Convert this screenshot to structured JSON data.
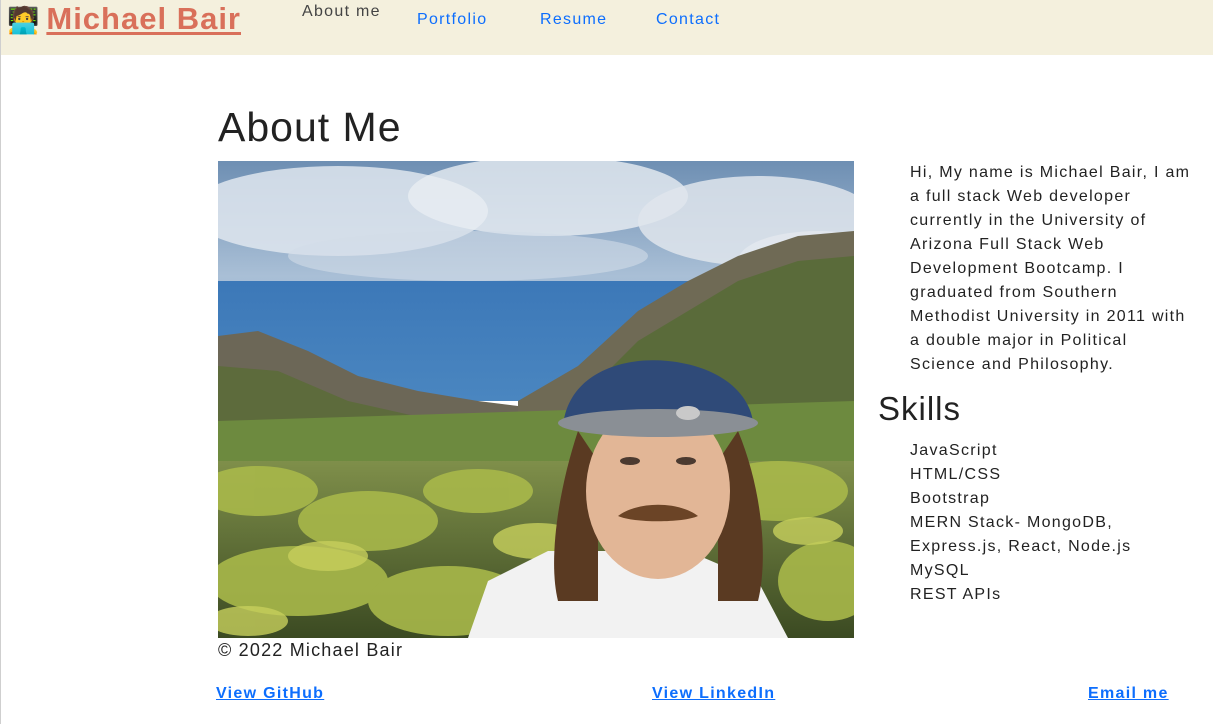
{
  "brand": {
    "emoji": "🧑‍💻",
    "name": "Michael Bair",
    "color": "#d9705a"
  },
  "nav": {
    "items": [
      {
        "label": "About me",
        "active": true
      },
      {
        "label": "Portfolio",
        "active": false
      },
      {
        "label": "Resume",
        "active": false
      },
      {
        "label": "Contact",
        "active": false
      }
    ],
    "background": "#f4f0dd",
    "link_color": "#0d6efd"
  },
  "about": {
    "title": "About Me",
    "bio": "Hi, My name is Michael Bair, I am a full stack Web developer currently in the University of Arizona Full Stack Web Development Bootcamp. I graduated from Southern Methodist University in 2011 with a double major in Political Science and Philosophy."
  },
  "skills": {
    "title": "Skills",
    "items": [
      "JavaScript",
      "HTML/CSS",
      "Bootstrap",
      "MERN Stack- MongoDB, Express.js, React, Node.js",
      "MySQL",
      "REST APIs"
    ]
  },
  "footer": {
    "copyright": "© 2022 Michael Bair",
    "links": [
      {
        "label": "View GitHub"
      },
      {
        "label": "View LinkedIn"
      },
      {
        "label": "Email me"
      }
    ]
  }
}
